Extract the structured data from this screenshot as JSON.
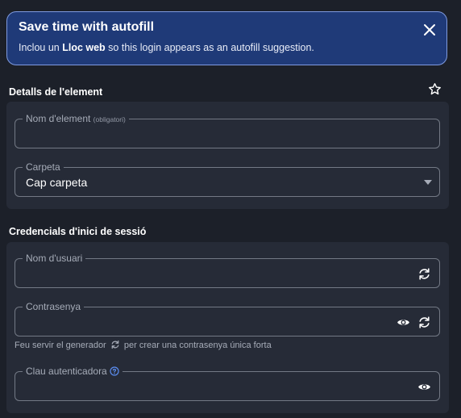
{
  "banner": {
    "title": "Save time with autofill",
    "text_before": "Inclou un ",
    "text_bold": "Lloc web",
    "text_after": " so this login appears as an autofill suggestion.",
    "close_icon": "close-icon"
  },
  "details": {
    "heading": "Detalls de l'element",
    "favorite_icon": "star-icon",
    "item_name_label": "Nom d'element",
    "item_name_required": "(obligatori)",
    "item_name_value": "",
    "folder_label": "Carpeta",
    "folder_value": "Cap carpeta"
  },
  "credentials": {
    "heading": "Credencials d'inici de sessió",
    "username_label": "Nom d'usuari",
    "username_value": "",
    "password_label": "Contrasenya",
    "password_value": "",
    "helper_before": "Feu servir el generador",
    "helper_after": "per crear una contrasenya única forta",
    "authenticator_label": "Clau autenticadora",
    "authenticator_value": ""
  },
  "colors": {
    "background": "#1c2029",
    "card": "#262b37",
    "banner": "#1f3a78",
    "banner_border": "#7f9be0",
    "help_icon": "#5b8df0"
  }
}
